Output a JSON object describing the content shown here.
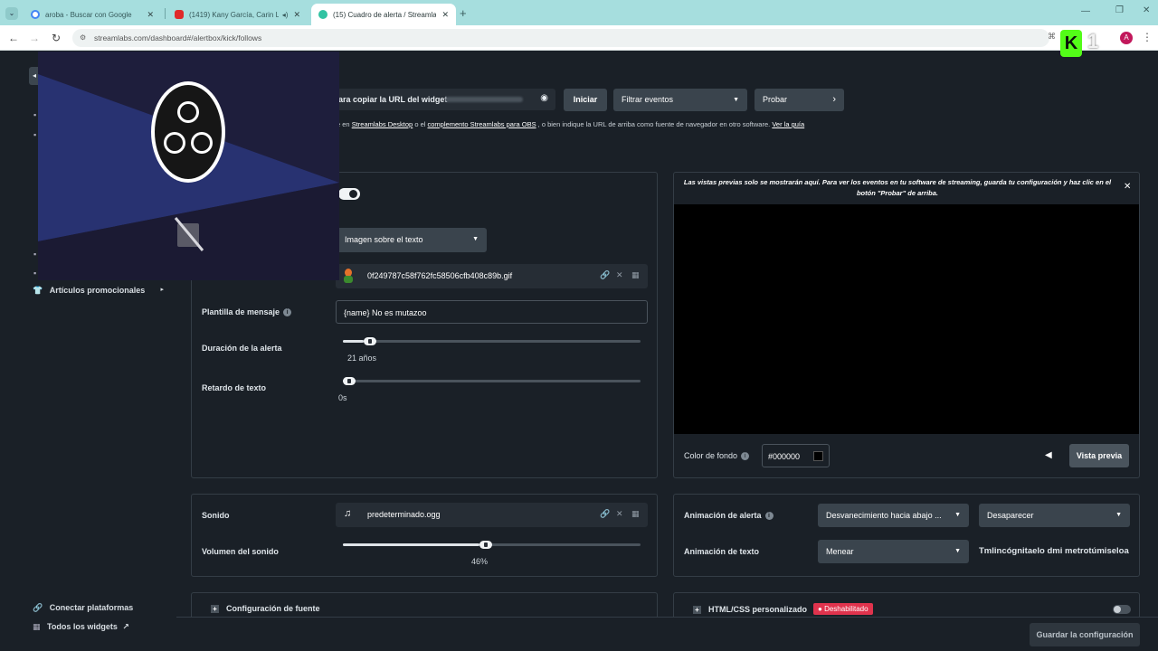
{
  "browser": {
    "tabs": [
      {
        "title": "aroba - Buscar con Google"
      },
      {
        "title": "(1419) Kany García, Carin Le"
      },
      {
        "title": "(15) Cuadro de alerta / Streamla"
      }
    ],
    "url": "streamlabs.com/dashboard#/alertbox/kick/follows",
    "profile_initial": "A",
    "extension_badge": "1"
  },
  "header": {
    "copy_url_label": "ara copiar la URL del widget",
    "start_label": "Iniciar",
    "filter_label": "Filtrar eventos",
    "test_label": "Probar",
    "help_prefix": "e en",
    "help_link1": "Streamlabs Desktop",
    "help_mid1": "o el",
    "help_link2": "complemento Streamlabs para OBS",
    "help_mid2": ", o bien indique la URL de arriba como fuente de navegador en otro software.",
    "help_link3": "Ver la guía"
  },
  "sidebar": {
    "promo_label": "Artículos promocionales",
    "connect_label": "Conectar plataformas",
    "widgets_label": "Todos los widgets"
  },
  "settings": {
    "layout_value": "Imagen sobre el texto",
    "image_file": "0f249787c58f762fc58506cfb408c89b.gif",
    "message_template_label": "Plantilla de mensaje",
    "message_template_value": "{name} No es mutazoo",
    "alert_duration_label": "Duración de la alerta",
    "alert_duration_value": "21 años",
    "alert_duration_fraction": 0.07,
    "text_delay_label": "Retardo de texto",
    "text_delay_value": "0s",
    "text_delay_fraction": 0.0
  },
  "preview": {
    "notice": "Las vistas previas solo se mostrarán aquí. Para ver los eventos en tu software de streaming, guarda tu configuración y haz clic en el botón \"Probar\" de arriba.",
    "bg_color_label": "Color de fondo",
    "bg_color_value": "#000000",
    "preview_button": "Vista previa"
  },
  "sound": {
    "label": "Sonido",
    "file": "predeterminado.ogg",
    "volume_label": "Volumen del sonido",
    "volume_value": "46%",
    "volume_fraction": 0.46
  },
  "animation": {
    "alert_label": "Animación de alerta",
    "alert_in": "Desvanecimiento hacia abajo ...",
    "alert_out": "Desaparecer",
    "text_label": "Animación de texto",
    "text_value": "Menear",
    "text_preview": "Tmlincógnitaelo dmi metrotúmiseloa"
  },
  "footer": {
    "font_config_label": "Configuración de fuente",
    "custom_html_label": "HTML/CSS personalizado",
    "disabled_badge": "Deshabilitado",
    "save_button": "Guardar la configuración"
  },
  "colors": {
    "page_bg": "#1a2027",
    "tabbar_bg": "#a6dede",
    "badge_red": "#e0334d",
    "overlay_blue": "#283271"
  }
}
